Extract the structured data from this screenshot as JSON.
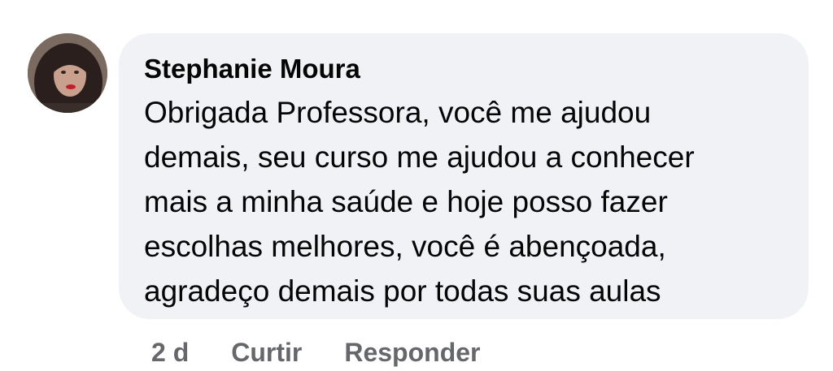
{
  "comment": {
    "author": "Stephanie Moura",
    "text": "Obrigada Professora, você me ajudou\ndemais, seu curso me ajudou a conhecer\nmais a minha saúde e hoje posso fazer\nescolhas melhores, você é abençoada,\nagradeço demais por todas suas aulas",
    "avatar_icon": "profile-photo"
  },
  "actions": {
    "timestamp": "2 d",
    "like_label": "Curtir",
    "reply_label": "Responder"
  },
  "colors": {
    "bubble_bg": "#f0f2f5",
    "text": "#050505",
    "secondary_text": "#65676b"
  }
}
